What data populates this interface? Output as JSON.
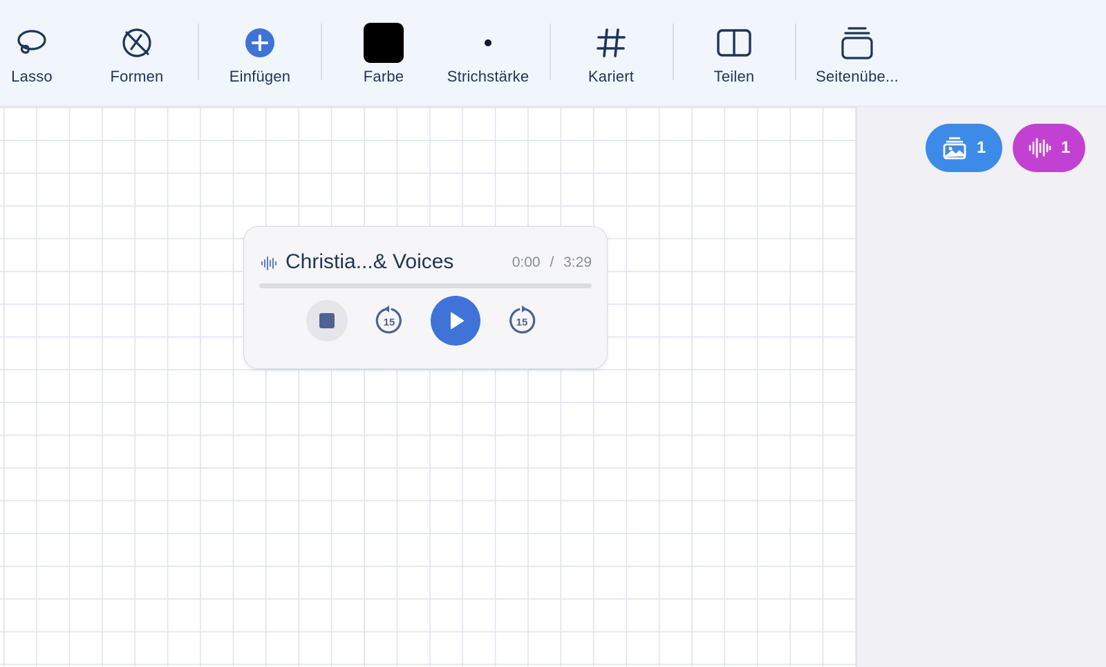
{
  "toolbar": {
    "items": [
      {
        "label": "Lasso",
        "icon": "lasso-icon"
      },
      {
        "label": "Formen",
        "icon": "shapes-off-icon"
      },
      {
        "label": "Einfügen",
        "icon": "plus-circle-icon"
      },
      {
        "label": "Farbe",
        "icon": "color-swatch-icon"
      },
      {
        "label": "Strichstärke",
        "icon": "stroke-dot-icon"
      },
      {
        "label": "Kariert",
        "icon": "grid-hash-icon"
      },
      {
        "label": "Teilen",
        "icon": "split-view-icon"
      },
      {
        "label": "Seitenübe...",
        "icon": "page-stack-icon"
      }
    ]
  },
  "badges": {
    "images": {
      "count": "1",
      "icon": "images-icon",
      "color": "#3d8be8"
    },
    "audio": {
      "count": "1",
      "icon": "waveform-icon",
      "color": "#c341d2"
    }
  },
  "player": {
    "title": "Christia...& Voices",
    "current": "0:00",
    "separator": "/",
    "duration": "3:29",
    "progress": 0,
    "skip_back": "15",
    "skip_forward": "15"
  },
  "colors": {
    "accent": "#3f73d8",
    "text": "#1f3556",
    "selected_color": "#000000"
  }
}
